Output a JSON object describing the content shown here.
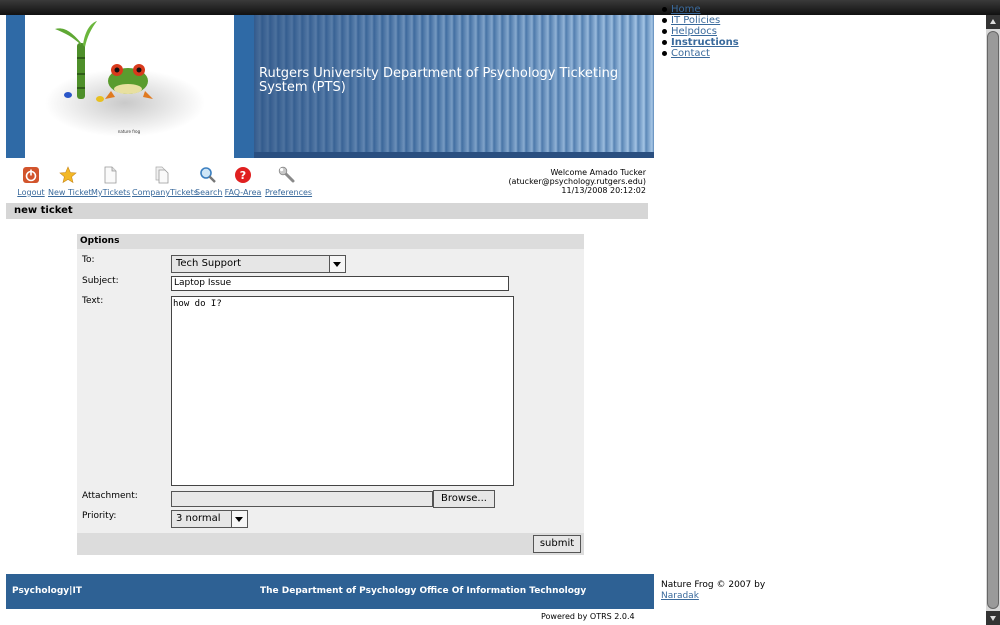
{
  "header": {
    "title": "Rutgers University Department of Psychology Ticketing System (PTS)",
    "logo_caption": "nature frog"
  },
  "right_nav": {
    "items": [
      {
        "label": "Home",
        "bold": false
      },
      {
        "label": "IT Policies",
        "bold": false
      },
      {
        "label": "Helpdocs",
        "bold": false
      },
      {
        "label": "Instructions",
        "bold": true
      },
      {
        "label": "Contact",
        "bold": false
      }
    ]
  },
  "toolbar": {
    "items": [
      {
        "label": "Logout",
        "icon": "power-icon"
      },
      {
        "label": "New Ticket",
        "icon": "star-icon"
      },
      {
        "label": "MyTickets",
        "icon": "document-icon"
      },
      {
        "label": "CompanyTickets",
        "icon": "documents-icon"
      },
      {
        "label": "Search",
        "icon": "magnifier-icon"
      },
      {
        "label": "FAQ-Area",
        "icon": "help-icon"
      },
      {
        "label": "Preferences",
        "icon": "wrench-icon"
      }
    ]
  },
  "welcome": {
    "line1": "Welcome Amado Tucker",
    "line2": "(atucker@psychology.rutgers.edu)",
    "line3": "11/13/2008 20:12:02"
  },
  "page": {
    "title": "new ticket"
  },
  "form": {
    "section_title": "Options",
    "to_label": "To:",
    "to_value": "Tech Support",
    "subject_label": "Subject:",
    "subject_value": "Laptop Issue",
    "text_label": "Text:",
    "text_value": "how do I?",
    "attachment_label": "Attachment:",
    "browse_label": "Browse...",
    "priority_label": "Priority:",
    "priority_value": "3 normal",
    "submit_label": "submit"
  },
  "footer": {
    "left": "Psychology|IT",
    "center": "The Department of Psychology Office Of Information Technology",
    "powered": "Powered by OTRS 2.0.4",
    "credit_text": "Nature Frog © 2007 by",
    "credit_link": "Naradak"
  },
  "colors": {
    "header_blue": "#2f6aa6",
    "footer_blue": "#2e6194",
    "link": "#3a6a9c"
  }
}
